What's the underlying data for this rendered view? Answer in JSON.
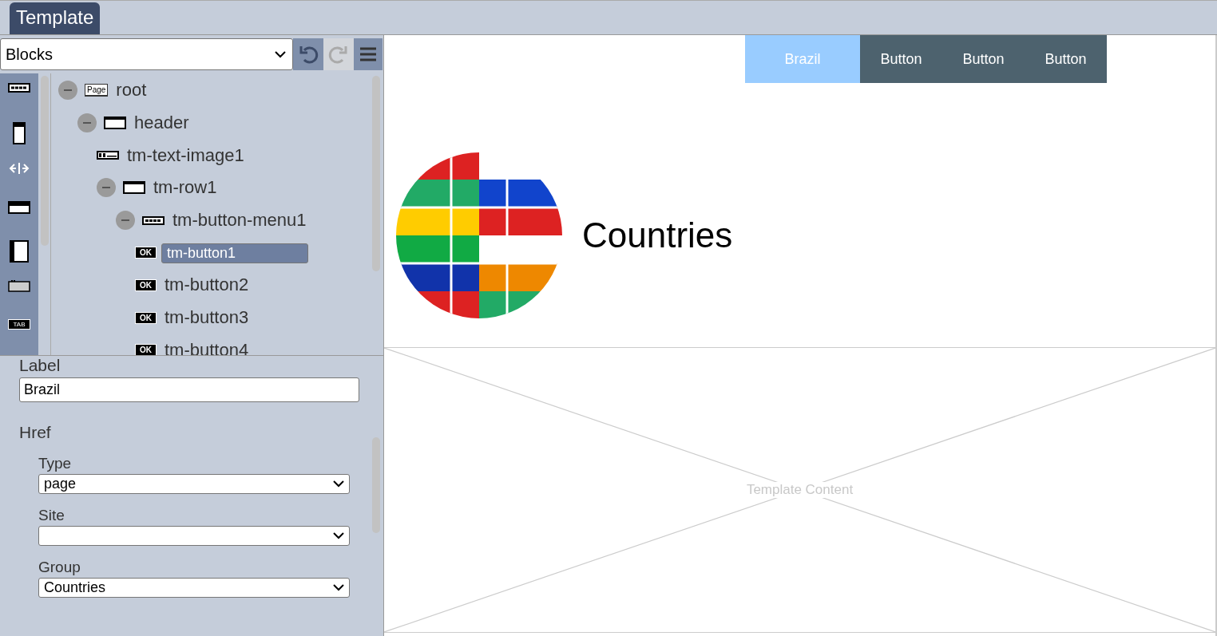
{
  "tabs": [
    {
      "label": "Template",
      "selected": true
    }
  ],
  "toolbar": {
    "block_select": "Blocks",
    "undo": {
      "disabled": false
    },
    "redo": {
      "disabled": true
    }
  },
  "palette": [
    {
      "kind": "menu"
    },
    {
      "kind": "column"
    },
    {
      "kind": "split"
    },
    {
      "kind": "header"
    },
    {
      "kind": "sidebar"
    },
    {
      "kind": "box"
    },
    {
      "kind": "tab",
      "label": "TAB"
    }
  ],
  "tree": [
    {
      "label": "root",
      "kind": "page",
      "badge": "Page",
      "expanded": true,
      "selected": false,
      "children": [
        {
          "label": "header",
          "kind": "row",
          "expanded": true,
          "selected": false,
          "children": [
            {
              "label": "tm-text-image1",
              "kind": "textimage",
              "selected": false
            },
            {
              "label": "tm-row1",
              "kind": "row",
              "expanded": true,
              "selected": false,
              "children": [
                {
                  "label": "tm-button-menu1",
                  "kind": "menu",
                  "expanded": true,
                  "selected": false,
                  "children": [
                    {
                      "label": "tm-button1",
                      "kind": "button",
                      "badge": "OK",
                      "selected": true
                    },
                    {
                      "label": "tm-button2",
                      "kind": "button",
                      "badge": "OK",
                      "selected": false
                    },
                    {
                      "label": "tm-button3",
                      "kind": "button",
                      "badge": "OK",
                      "selected": false
                    },
                    {
                      "label": "tm-button4",
                      "kind": "button",
                      "badge": "OK",
                      "selected": false
                    }
                  ]
                }
              ]
            }
          ]
        }
      ]
    }
  ],
  "properties": {
    "label_field": {
      "label": "Label",
      "value": "Brazil"
    },
    "href": {
      "heading": "Href",
      "fields": [
        {
          "label": "Type",
          "value": "page"
        },
        {
          "label": "Site"
        },
        {
          "label": "Group",
          "value": "Countries"
        }
      ]
    }
  },
  "preview": {
    "nav": [
      {
        "label": "Brazil",
        "selected": true
      },
      {
        "label": "Button",
        "selected": false
      },
      {
        "label": "Button",
        "selected": false
      },
      {
        "label": "Button",
        "selected": false
      }
    ],
    "title": "Countries",
    "content_placeholder": "Template Content"
  }
}
